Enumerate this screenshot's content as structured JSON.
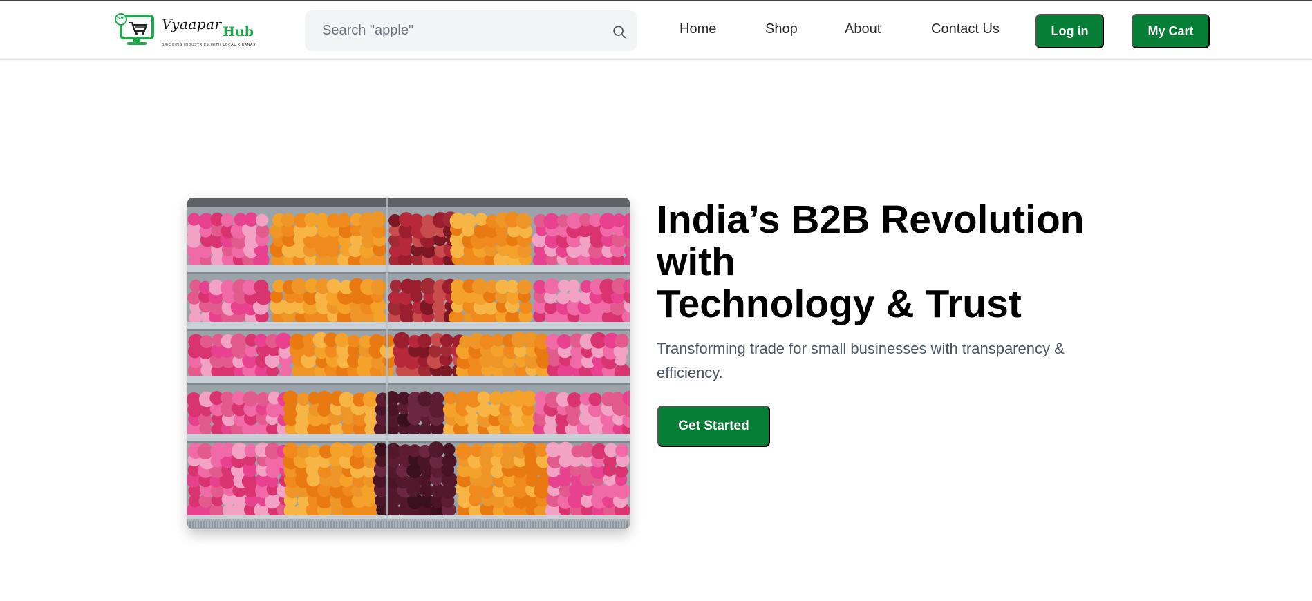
{
  "brand": {
    "logo_text": "Vyaapar",
    "logo_suffix": "Hub",
    "logo_tagline": "BRIDGING INDUSTRIES WITH LOCAL KIRANAS",
    "icon_badge": "B2B",
    "primary_color": "#067e35",
    "accent_color": "#1ea84a"
  },
  "search": {
    "placeholder": "Search \"apple\"",
    "icon": "search-icon"
  },
  "nav": {
    "items": [
      {
        "label": "Home"
      },
      {
        "label": "Shop"
      },
      {
        "label": "About"
      },
      {
        "label": "Contact Us"
      }
    ],
    "login_label": "Log in",
    "cart_label": "My Cart"
  },
  "hero": {
    "title_line1": "India’s B2B Revolution",
    "title_line2": "with",
    "title_line3": "Technology & Trust",
    "subtitle": "Transforming trade for small businesses with transparency & efficiency.",
    "cta_label": "Get Started"
  }
}
